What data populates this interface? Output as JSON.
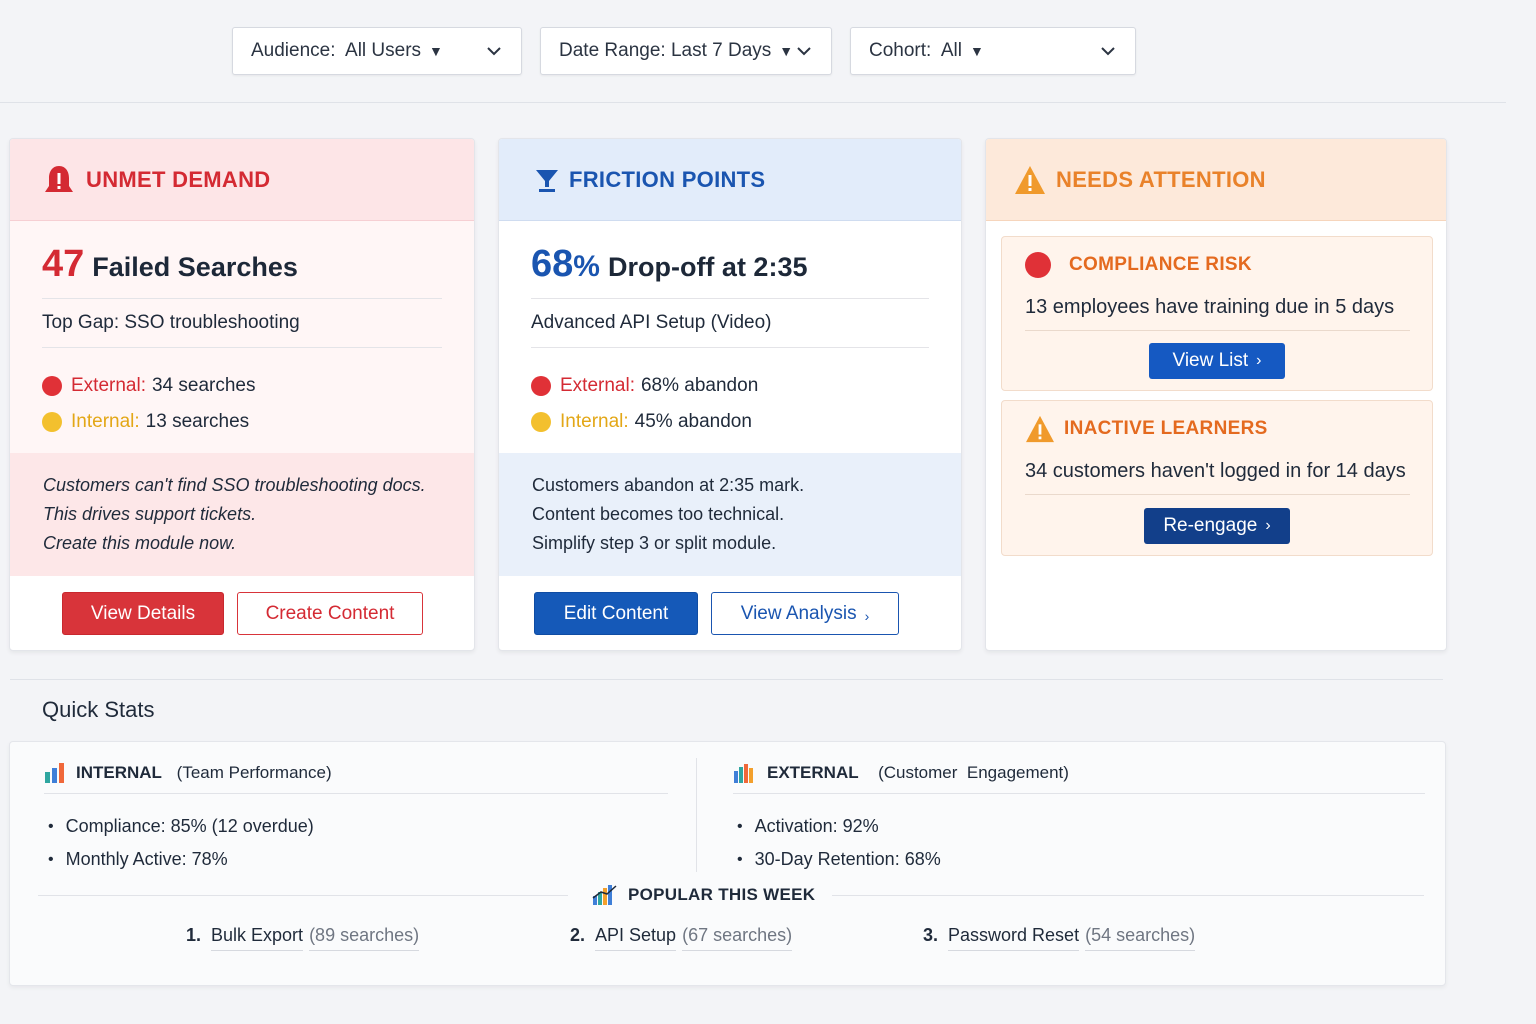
{
  "filters": [
    {
      "label": "Audience:  All Users"
    },
    {
      "label": "Date Range: Last 7 Days"
    },
    {
      "label": "Cohort:  All"
    }
  ],
  "cards": {
    "unmet_demand": {
      "title": "UNMET DEMAND",
      "metric_value": "47",
      "metric_text": "Failed Searches",
      "subtitle": "Top Gap: SSO troubleshooting",
      "external_label": "External:",
      "external_value": "34 searches",
      "internal_label": "Internal:",
      "internal_value": "13 searches",
      "note": [
        "Customers can't find SSO troubleshooting docs.",
        "This drives support tickets.",
        "Create this module now."
      ],
      "primary_button": "View Details",
      "secondary_button": "Create Content",
      "accent_color": "#d42a33"
    },
    "friction_points": {
      "title": "FRICTION POINTS",
      "metric_value": "68",
      "metric_unit": "%",
      "metric_text": "Drop-off at 2:35",
      "subtitle": "Advanced API Setup (Video)",
      "external_label": "External:",
      "external_value": "68% abandon",
      "internal_label": "Internal:",
      "internal_value": "45% abandon",
      "note": [
        "Customers abandon at 2:35 mark.",
        "Content becomes too technical.",
        "Simplify step 3 or split module."
      ],
      "primary_button": "Edit Content",
      "secondary_button": "View Analysis",
      "accent_color": "#1a55b0"
    },
    "needs_attention": {
      "title": "NEEDS ATTENTION",
      "accent_color": "#e9822a",
      "items": [
        {
          "title": "COMPLIANCE RISK",
          "text": "13 employees have training due in 5 days",
          "button": "View List"
        },
        {
          "title": "INACTIVE LEARNERS",
          "text": "34 customers haven't logged in for 14 days",
          "button": "Re-engage"
        }
      ]
    }
  },
  "quick_stats": {
    "title": "Quick Stats",
    "internal": {
      "label": "INTERNAL",
      "sub": " (Team Performance)",
      "items": [
        "Compliance: 85% (12 overdue)",
        "Monthly Active: 78%"
      ]
    },
    "external": {
      "label": "EXTERNAL",
      "sub": "  (Customer  Engagement)",
      "items": [
        "Activation: 92%",
        "30-Day Retention: 68%"
      ]
    },
    "popular": {
      "title": "POPULAR THIS WEEK",
      "items": [
        {
          "num": "1.",
          "name": "Bulk Export",
          "count": "(89 searches)"
        },
        {
          "num": "2.",
          "name": "API Setup",
          "count": "(67 searches)"
        },
        {
          "num": "3.",
          "name": "Password Reset",
          "count": "(54 searches)"
        }
      ]
    }
  }
}
